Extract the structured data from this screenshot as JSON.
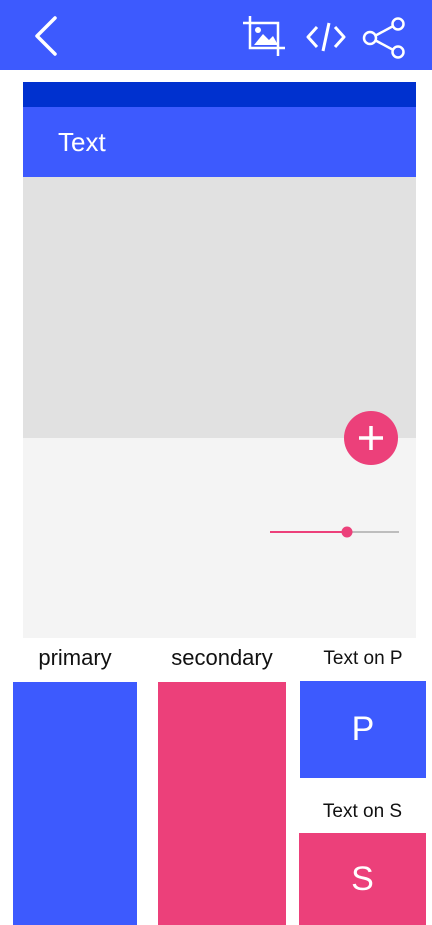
{
  "toolbar": {
    "back_icon": "back-arrow-icon",
    "crop_image_icon": "crop-image-icon",
    "code_icon": "code-icon",
    "share_icon": "share-icon",
    "background_color": "#3d5afe"
  },
  "preview": {
    "statusbar_color": "#0031cf",
    "appbar_title": "Text",
    "appbar_color": "#3d5afe",
    "fab_icon": "plus-icon",
    "fab_color": "#ec407a",
    "slider_value_fraction": 0.6
  },
  "palette": {
    "primary_label": "primary",
    "secondary_label": "secondary",
    "text_on_primary_label": "Text on P",
    "text_on_secondary_label": "Text on S",
    "primary_sample": "P",
    "secondary_sample": "S",
    "primary_color": "#3d5afe",
    "secondary_color": "#ec407a"
  }
}
